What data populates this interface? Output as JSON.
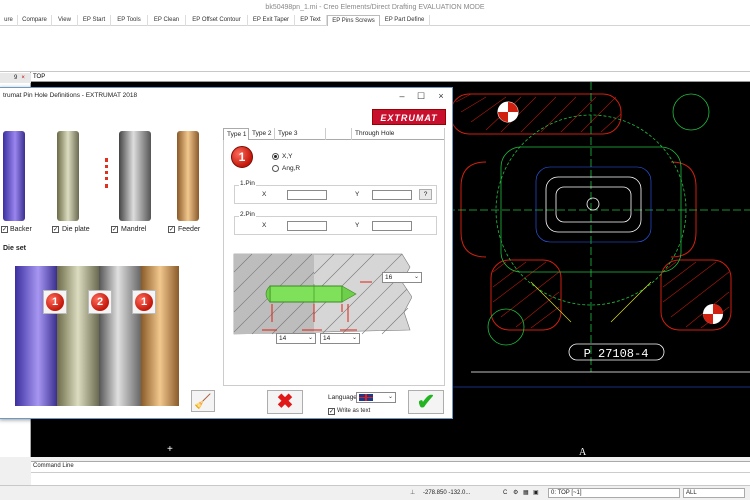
{
  "window": {
    "title": "bk50498pn_1.mi - Creo Elements/Direct Drafting EVALUATION MODE"
  },
  "ribbon": {
    "tabs": [
      {
        "label": "ure"
      },
      {
        "label": "Compare"
      },
      {
        "label": "View"
      },
      {
        "label": "EP Start"
      },
      {
        "label": "EP Tools"
      },
      {
        "label": "EP Clean"
      },
      {
        "label": "EP Offset Contour"
      },
      {
        "label": "EP Exit Taper"
      },
      {
        "label": "EP Text"
      },
      {
        "label": "EP Pins  Screws"
      },
      {
        "label": "EP Part Define"
      }
    ],
    "active_tab": "EP Pins  Screws"
  },
  "left_panel": {
    "header_value": "9"
  },
  "viewport": {
    "label": "TOP",
    "drawing_label": "P 27108-4",
    "marker": "A"
  },
  "dialog": {
    "title": "trumat Pin Hole Definitions  -  EXTRUMAT 2018",
    "brand": "EXTRUMAT",
    "components": [
      {
        "label": "Backer",
        "checked": true
      },
      {
        "label": "Die plate",
        "checked": true
      },
      {
        "label": "Mandrel",
        "checked": true
      },
      {
        "label": "Feeder",
        "checked": true
      }
    ],
    "die_set": {
      "label": "Die set",
      "badges": [
        "1",
        "2",
        "1"
      ]
    },
    "tabs": [
      "Type 1",
      "Type 2",
      "Type 3",
      "",
      "Through Hole"
    ],
    "active_tab": "Type 1",
    "type_badge": "1",
    "coord_options": [
      {
        "label": "X,Y",
        "selected": true
      },
      {
        "label": "Ang,R",
        "selected": false
      }
    ],
    "pin1": {
      "title": "1.Pin",
      "x_label": "X",
      "y_label": "Y",
      "x_value": "",
      "y_value": "",
      "help_button": "?"
    },
    "pin2": {
      "title": "2.Pin",
      "x_label": "X",
      "y_label": "Y",
      "x_value": "",
      "y_value": ""
    },
    "pin_diameter": "16",
    "depth_1": "14",
    "depth_2": "14",
    "language_label": "Language",
    "write_as_text": {
      "label": "Write as text",
      "checked": true
    }
  },
  "command_line": {
    "label": "Command Line",
    "value": ""
  },
  "status_bar": {
    "coords": "-278.850    -132.0...",
    "view": "0: TOP [~1]",
    "filter": "ALL"
  },
  "colors": {
    "brand_red": "#c8102e",
    "badge_red": "#d81e0e",
    "cad_red": "#d02010",
    "cad_green": "#20c040",
    "cad_white": "#ffffff",
    "cad_blue": "#3060ff",
    "cad_yellow": "#e0e020"
  }
}
